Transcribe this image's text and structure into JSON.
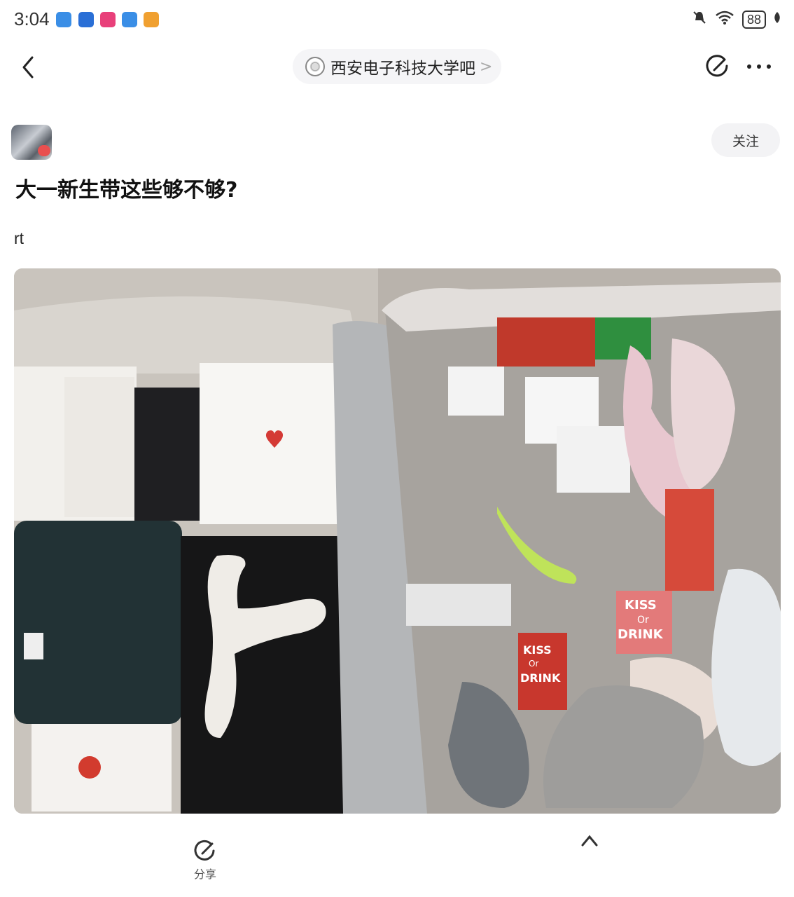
{
  "status_bar": {
    "time": "3:04",
    "battery": "88",
    "notification_colors": [
      "#3a8ee6",
      "#2a6fd6",
      "#e8407a",
      "#3a8ee6",
      "#f0a030"
    ]
  },
  "header": {
    "forum_name": "西安电子科技大学吧",
    "forum_chevron": ">"
  },
  "author": {
    "follow_label": "关注"
  },
  "post": {
    "title": "大一新生带这些够不够?",
    "body": "rt"
  },
  "actions": {
    "share_label": "分享"
  },
  "photo": {
    "printed_text": [
      "KISS",
      "Or",
      "DRINK",
      "KISS",
      "Or",
      "DRINK"
    ]
  }
}
